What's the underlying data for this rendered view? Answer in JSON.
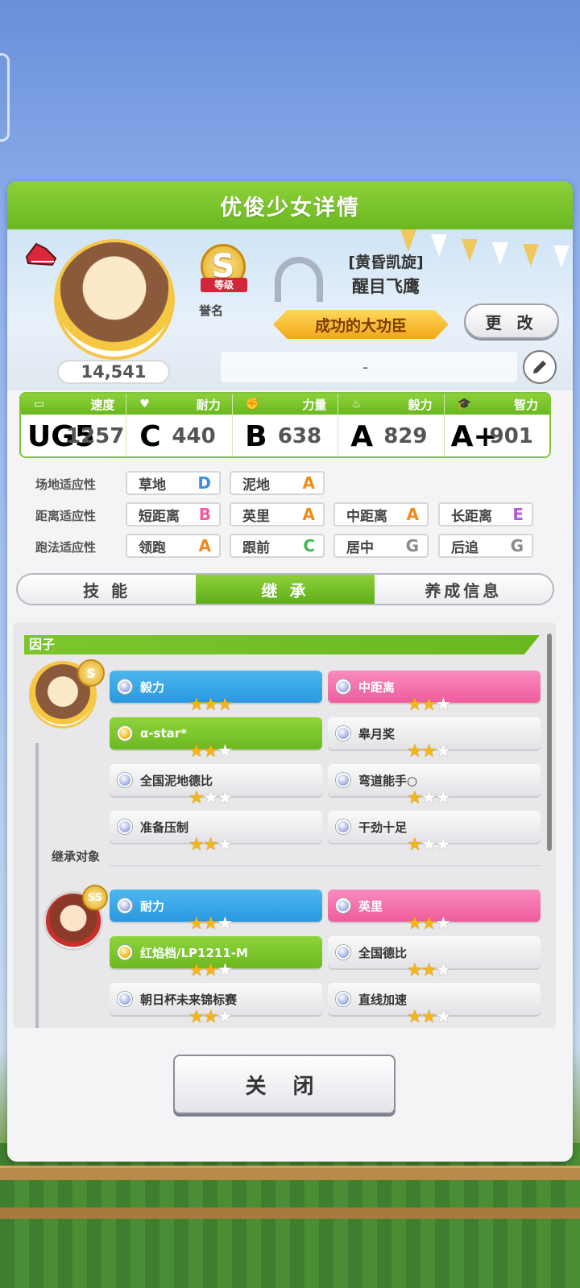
{
  "header": {
    "title": "优俊少女详情"
  },
  "profile": {
    "fans": "14,541",
    "rank": {
      "letter": "S",
      "ribbon": "等级",
      "caption": "誉名"
    },
    "epithet": "[黄昏凯旋]",
    "name": "醒目飞鹰",
    "title": "成功的大功臣",
    "change_label": "更 改",
    "comment": "-"
  },
  "stats": [
    {
      "label": "速度",
      "grade": "UG5",
      "value": "1257",
      "color": "#6b6fd8"
    },
    {
      "label": "耐力",
      "grade": "C",
      "value": "440",
      "color": "#3fb94a"
    },
    {
      "label": "力量",
      "grade": "B",
      "value": "638",
      "color": "#ef5c9d"
    },
    {
      "label": "毅力",
      "grade": "A",
      "value": "829",
      "color": "#f08a1a"
    },
    {
      "label": "智力",
      "grade": "A+",
      "value": "901",
      "color": "#f08a1a"
    }
  ],
  "aptitude": {
    "rows": [
      {
        "label": "场地适应性",
        "items": [
          {
            "name": "草地",
            "grade": "D"
          },
          {
            "name": "泥地",
            "grade": "A"
          }
        ]
      },
      {
        "label": "距离适应性",
        "items": [
          {
            "name": "短距离",
            "grade": "B"
          },
          {
            "name": "英里",
            "grade": "A"
          },
          {
            "name": "中距离",
            "grade": "A"
          },
          {
            "name": "长距离",
            "grade": "E"
          }
        ]
      },
      {
        "label": "跑法适应性",
        "items": [
          {
            "name": "领跑",
            "grade": "A"
          },
          {
            "name": "跟前",
            "grade": "C"
          },
          {
            "name": "居中",
            "grade": "G"
          },
          {
            "name": "后追",
            "grade": "G"
          }
        ]
      }
    ],
    "grade_colors": {
      "A": "#f08a1a",
      "B": "#ef5c9d",
      "C": "#3fb94a",
      "D": "#3d8ee0",
      "E": "#b05cd0",
      "G": "#8a8a8a"
    }
  },
  "tabs": [
    {
      "label": "技 能",
      "active": false
    },
    {
      "label": "继 承",
      "active": true
    },
    {
      "label": "养成信息",
      "active": false
    }
  ],
  "factors": {
    "title": "因子",
    "inherit_label": "继承对象",
    "main_rank": "S",
    "parent_rank": "SS",
    "main": [
      {
        "name": "毅力",
        "stars": 3,
        "color": "blue"
      },
      {
        "name": "中距离",
        "stars": 2,
        "color": "pink"
      },
      {
        "name": "α-star*",
        "stars": 2,
        "color": "green"
      },
      {
        "name": "皋月奖",
        "stars": 2,
        "color": "white"
      },
      {
        "name": "全国泥地德比",
        "stars": 1,
        "color": "white"
      },
      {
        "name": "弯道能手○",
        "stars": 1,
        "color": "white"
      },
      {
        "name": "准备压制",
        "stars": 2,
        "color": "white"
      },
      {
        "name": "干劲十足",
        "stars": 1,
        "color": "white"
      }
    ],
    "parent": [
      {
        "name": "耐力",
        "stars": 2,
        "color": "blue"
      },
      {
        "name": "英里",
        "stars": 2,
        "color": "pink"
      },
      {
        "name": "红焰档/LP1211-M",
        "stars": 2,
        "color": "green"
      },
      {
        "name": "全国德比",
        "stars": 2,
        "color": "white"
      },
      {
        "name": "朝日杯未来锦标赛",
        "stars": 2,
        "color": "white"
      },
      {
        "name": "直线加速",
        "stars": 2,
        "color": "white"
      }
    ]
  },
  "close_label": "关 闭"
}
